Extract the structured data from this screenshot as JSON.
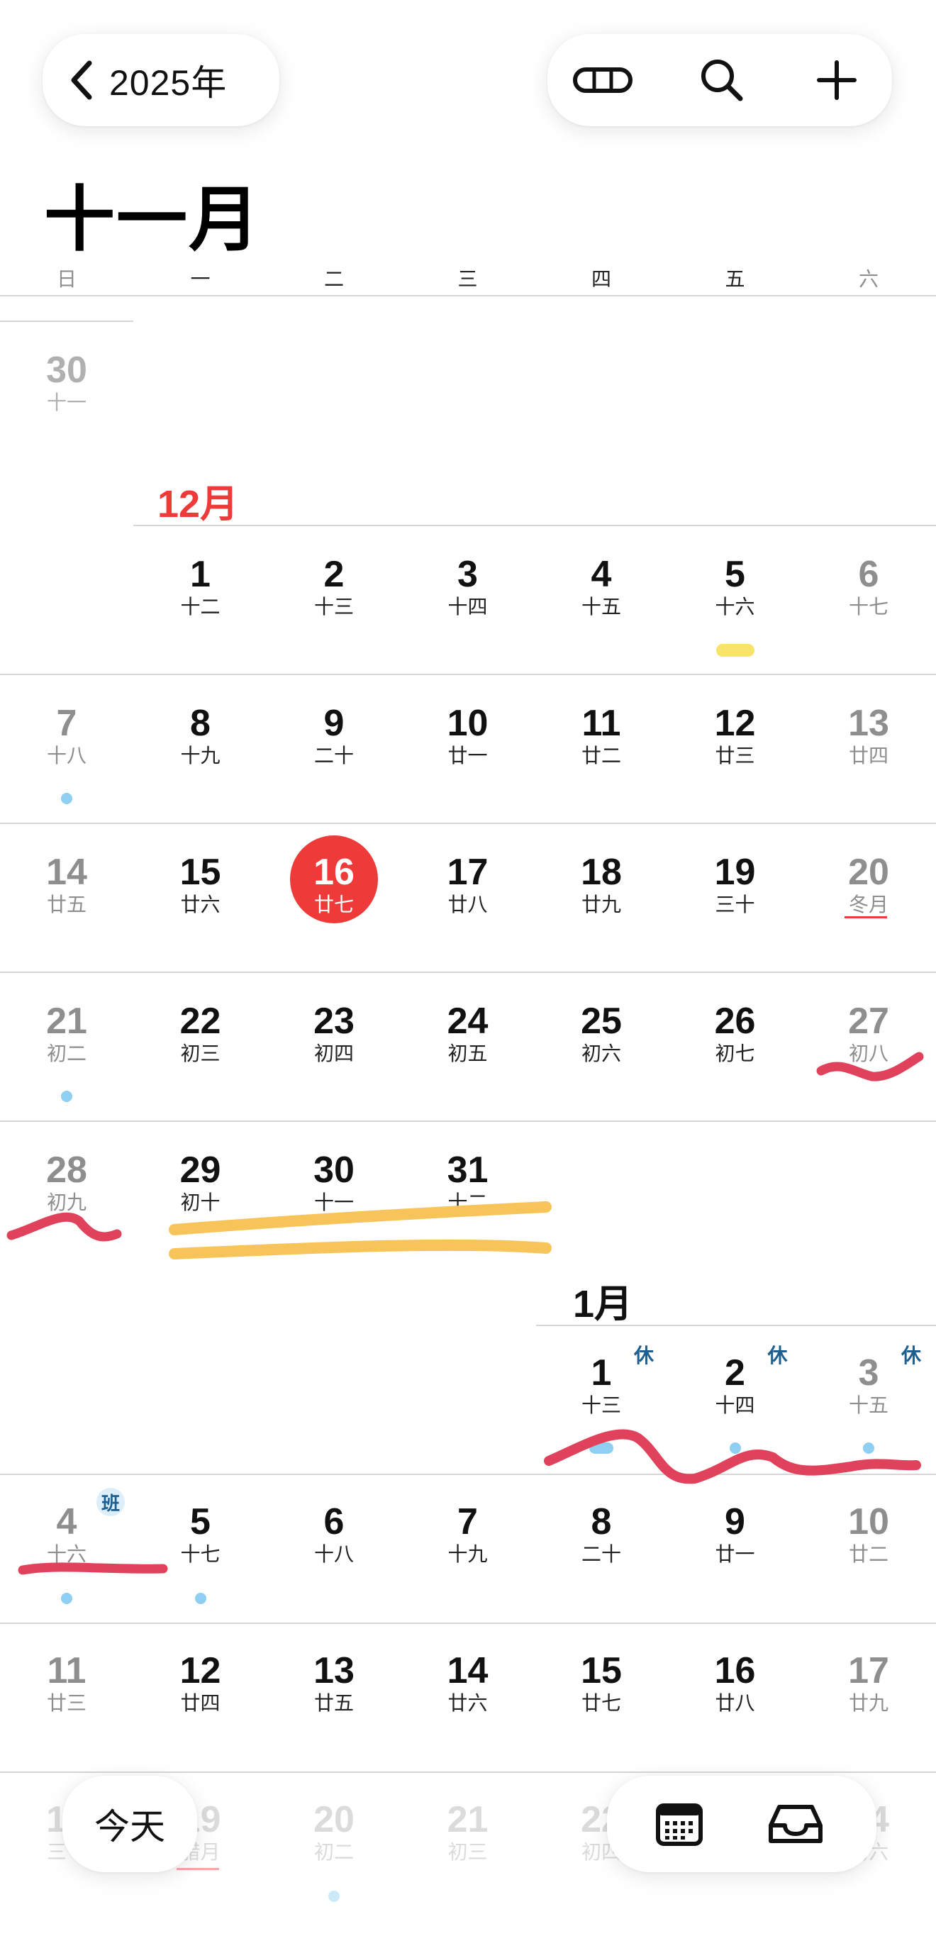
{
  "header": {
    "back_label": "2025年",
    "month_title": "十一月",
    "weekdays": [
      "日",
      "一",
      "二",
      "三",
      "四",
      "五",
      "六"
    ],
    "icons": [
      "chevron-left-icon",
      "view-toggle-icon",
      "search-icon",
      "add-icon"
    ]
  },
  "nov_tail": {
    "day": "30",
    "lunar": "十一"
  },
  "dec": {
    "label": "12月",
    "weeks": [
      [
        null,
        {
          "d": "1",
          "l": "十二"
        },
        {
          "d": "2",
          "l": "十三"
        },
        {
          "d": "3",
          "l": "十四"
        },
        {
          "d": "4",
          "l": "十五"
        },
        {
          "d": "5",
          "l": "十六"
        },
        {
          "d": "6",
          "l": "十七"
        }
      ],
      [
        {
          "d": "7",
          "l": "十八"
        },
        {
          "d": "8",
          "l": "十九"
        },
        {
          "d": "9",
          "l": "二十"
        },
        {
          "d": "10",
          "l": "廿一"
        },
        {
          "d": "11",
          "l": "廿二"
        },
        {
          "d": "12",
          "l": "廿三"
        },
        {
          "d": "13",
          "l": "廿四"
        }
      ],
      [
        {
          "d": "14",
          "l": "廿五"
        },
        {
          "d": "15",
          "l": "廿六"
        },
        {
          "d": "16",
          "l": "廿七"
        },
        {
          "d": "17",
          "l": "廿八"
        },
        {
          "d": "18",
          "l": "廿九"
        },
        {
          "d": "19",
          "l": "三十"
        },
        {
          "d": "20",
          "l": "冬月"
        }
      ],
      [
        {
          "d": "21",
          "l": "初二"
        },
        {
          "d": "22",
          "l": "初三"
        },
        {
          "d": "23",
          "l": "初四"
        },
        {
          "d": "24",
          "l": "初五"
        },
        {
          "d": "25",
          "l": "初六"
        },
        {
          "d": "26",
          "l": "初七"
        },
        {
          "d": "27",
          "l": "初八"
        }
      ],
      [
        {
          "d": "28",
          "l": "初九"
        },
        {
          "d": "29",
          "l": "初十"
        },
        {
          "d": "30",
          "l": "十一"
        },
        {
          "d": "31",
          "l": "十二"
        }
      ]
    ]
  },
  "jan": {
    "label": "1月",
    "weeks": [
      [
        null,
        null,
        null,
        null,
        {
          "d": "1",
          "l": "十三"
        },
        {
          "d": "2",
          "l": "十四"
        },
        {
          "d": "3",
          "l": "十五"
        }
      ],
      [
        {
          "d": "4",
          "l": "十六"
        },
        {
          "d": "5",
          "l": "十七"
        },
        {
          "d": "6",
          "l": "十八"
        },
        {
          "d": "7",
          "l": "十九"
        },
        {
          "d": "8",
          "l": "二十"
        },
        {
          "d": "9",
          "l": "廿一"
        },
        {
          "d": "10",
          "l": "廿二"
        }
      ],
      [
        {
          "d": "11",
          "l": "廿三"
        },
        {
          "d": "12",
          "l": "廿四"
        },
        {
          "d": "13",
          "l": "廿五"
        },
        {
          "d": "14",
          "l": "廿六"
        },
        {
          "d": "15",
          "l": "廿七"
        },
        {
          "d": "16",
          "l": "廿八"
        },
        {
          "d": "17",
          "l": "廿九"
        }
      ],
      [
        {
          "d": "18",
          "l": "三十"
        },
        {
          "d": "19",
          "l": "腊月"
        },
        {
          "d": "20",
          "l": "初二"
        },
        {
          "d": "21",
          "l": "初三"
        },
        {
          "d": "22",
          "l": "初四"
        },
        {
          "d": "23",
          "l": "初五"
        },
        {
          "d": "24",
          "l": "初六"
        }
      ]
    ],
    "holiday_label": "休",
    "workday_label": "班"
  },
  "bottom": {
    "today_label": "今天",
    "icons": [
      "calendar-grid-icon",
      "inbox-icon"
    ]
  },
  "colors": {
    "accent_red": "#ef3a3a",
    "event_blue": "#8ecff2",
    "event_yellow": "#f8e36b",
    "holiday_blue": "#1e5f8f"
  }
}
